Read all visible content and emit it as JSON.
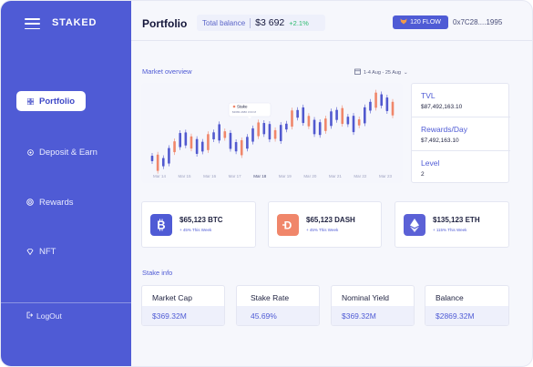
{
  "app": {
    "brand": "STAKED"
  },
  "sidebar": {
    "items": [
      {
        "label": "Portfolio",
        "icon": "grid-icon",
        "active": true
      },
      {
        "label": "Deposit & Earn",
        "icon": "deposit-icon",
        "active": false
      },
      {
        "label": "Rewards",
        "icon": "rewards-icon",
        "active": false
      },
      {
        "label": "NFT",
        "icon": "nft-icon",
        "active": false
      }
    ],
    "logout_label": "LogOut"
  },
  "header": {
    "title": "Portfolio",
    "balance_label": "Total balance",
    "balance_value": "$3 692",
    "balance_change": "+2.1%",
    "flow_label": "120 FLOW",
    "wallet_address": "0x7C28....1995"
  },
  "market": {
    "title": "Market overview",
    "date_range": "1-4 Aug - 25 Aug",
    "tooltip_title": "Stake",
    "tooltip_value": "$3680-4680 3:03 M"
  },
  "chart_data": {
    "type": "candlestick",
    "categories": [
      "Mar 14",
      "Mar 15",
      "Mar 16",
      "Mar 17",
      "Mar 18",
      "Mar 19",
      "Mar 20",
      "Mar 21",
      "Mar 22",
      "Mar 23"
    ]
  },
  "stats": [
    {
      "label": "TVL",
      "value": "$87,492,163.10"
    },
    {
      "label": "Rewards/Day",
      "value": "$7,492,163.10"
    },
    {
      "label": "Level",
      "value": "2"
    }
  ],
  "coins": [
    {
      "value": "$65,123 BTC",
      "week": "+ 45% This Week",
      "icon": "bitcoin-icon",
      "color": "#4f5bd5"
    },
    {
      "value": "$65,123 DASH",
      "week": "+ 45% This Week",
      "icon": "dash-icon",
      "color": "#f0866a"
    },
    {
      "value": "$135,123 ETH",
      "week": "+ 115% This Week",
      "icon": "ethereum-icon",
      "color": "#5b61d6"
    }
  ],
  "stake": {
    "title": "Stake info",
    "items": [
      {
        "label": "Market Cap",
        "value": "$369.32M"
      },
      {
        "label": "Stake Rate",
        "value": "45.69%"
      },
      {
        "label": "Nominal Yield",
        "value": "$369.32M"
      },
      {
        "label": "Balance",
        "value": "$2869.32M"
      }
    ]
  },
  "colors": {
    "accent": "#4f5bd5",
    "candle_up": "#5159cf",
    "candle_down": "#f0866a",
    "positive": "#2dbb6f"
  }
}
